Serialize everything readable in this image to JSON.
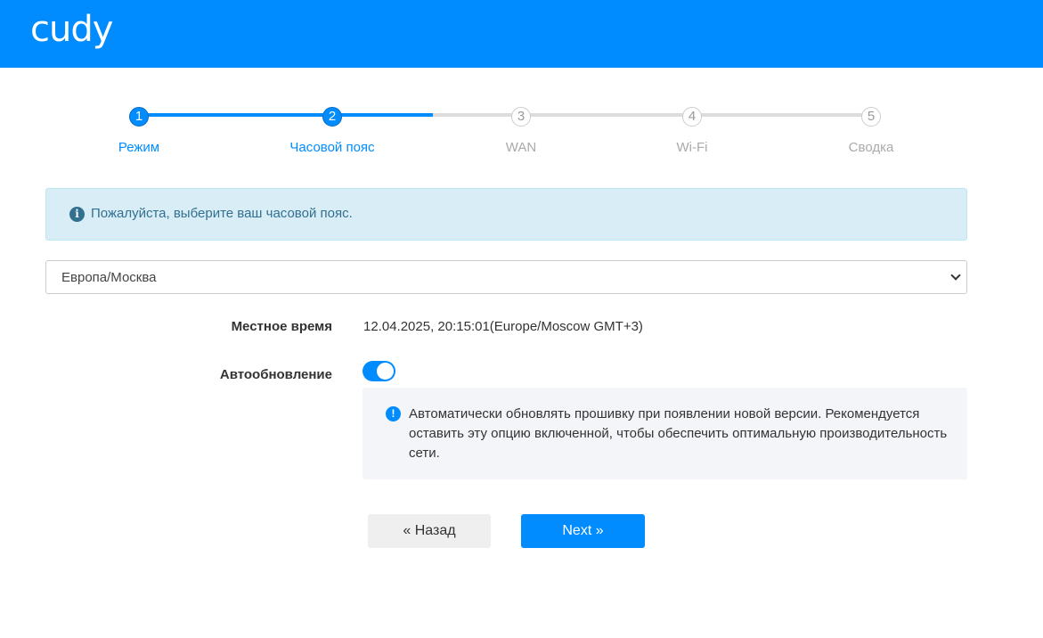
{
  "header": {
    "logo": "cudy"
  },
  "steps": [
    {
      "num": "1",
      "label": "Режим",
      "state": "done"
    },
    {
      "num": "2",
      "label": "Часовой пояс",
      "state": "current"
    },
    {
      "num": "3",
      "label": "WAN",
      "state": "todo"
    },
    {
      "num": "4",
      "label": "Wi-Fi",
      "state": "todo"
    },
    {
      "num": "5",
      "label": "Сводка",
      "state": "todo"
    }
  ],
  "alert": {
    "icon": "info-icon",
    "text": "Пожалуйста, выберите ваш часовой пояс."
  },
  "timezone_select": {
    "value": "Европа/Москва"
  },
  "local_time": {
    "label": "Местное время",
    "value": "12.04.2025, 20:15:01(Europe/Moscow GMT+3)"
  },
  "auto_update": {
    "label": "Автообновление",
    "enabled": true,
    "notice": "Автоматически обновлять прошивку при появлении новой версии. Рекомендуется оставить эту опцию включенной, чтобы обеспечить оптимальную производительность сети."
  },
  "buttons": {
    "back": "« Назад",
    "next": "Next »"
  },
  "colors": {
    "brand": "#008cff",
    "alert_bg": "#d9edf7"
  }
}
